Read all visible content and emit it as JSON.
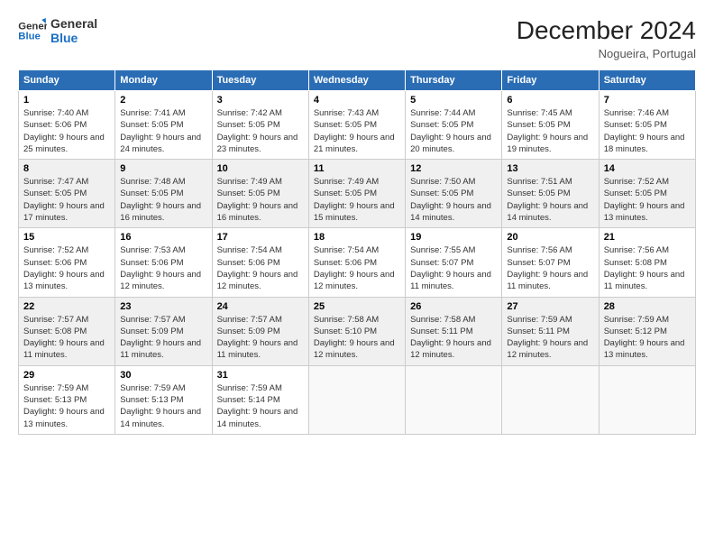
{
  "header": {
    "logo_line1": "General",
    "logo_line2": "Blue",
    "month": "December 2024",
    "location": "Nogueira, Portugal"
  },
  "weekdays": [
    "Sunday",
    "Monday",
    "Tuesday",
    "Wednesday",
    "Thursday",
    "Friday",
    "Saturday"
  ],
  "weeks": [
    [
      {
        "day": "1",
        "sunrise": "Sunrise: 7:40 AM",
        "sunset": "Sunset: 5:06 PM",
        "daylight": "Daylight: 9 hours and 25 minutes."
      },
      {
        "day": "2",
        "sunrise": "Sunrise: 7:41 AM",
        "sunset": "Sunset: 5:05 PM",
        "daylight": "Daylight: 9 hours and 24 minutes."
      },
      {
        "day": "3",
        "sunrise": "Sunrise: 7:42 AM",
        "sunset": "Sunset: 5:05 PM",
        "daylight": "Daylight: 9 hours and 23 minutes."
      },
      {
        "day": "4",
        "sunrise": "Sunrise: 7:43 AM",
        "sunset": "Sunset: 5:05 PM",
        "daylight": "Daylight: 9 hours and 21 minutes."
      },
      {
        "day": "5",
        "sunrise": "Sunrise: 7:44 AM",
        "sunset": "Sunset: 5:05 PM",
        "daylight": "Daylight: 9 hours and 20 minutes."
      },
      {
        "day": "6",
        "sunrise": "Sunrise: 7:45 AM",
        "sunset": "Sunset: 5:05 PM",
        "daylight": "Daylight: 9 hours and 19 minutes."
      },
      {
        "day": "7",
        "sunrise": "Sunrise: 7:46 AM",
        "sunset": "Sunset: 5:05 PM",
        "daylight": "Daylight: 9 hours and 18 minutes."
      }
    ],
    [
      {
        "day": "8",
        "sunrise": "Sunrise: 7:47 AM",
        "sunset": "Sunset: 5:05 PM",
        "daylight": "Daylight: 9 hours and 17 minutes."
      },
      {
        "day": "9",
        "sunrise": "Sunrise: 7:48 AM",
        "sunset": "Sunset: 5:05 PM",
        "daylight": "Daylight: 9 hours and 16 minutes."
      },
      {
        "day": "10",
        "sunrise": "Sunrise: 7:49 AM",
        "sunset": "Sunset: 5:05 PM",
        "daylight": "Daylight: 9 hours and 16 minutes."
      },
      {
        "day": "11",
        "sunrise": "Sunrise: 7:49 AM",
        "sunset": "Sunset: 5:05 PM",
        "daylight": "Daylight: 9 hours and 15 minutes."
      },
      {
        "day": "12",
        "sunrise": "Sunrise: 7:50 AM",
        "sunset": "Sunset: 5:05 PM",
        "daylight": "Daylight: 9 hours and 14 minutes."
      },
      {
        "day": "13",
        "sunrise": "Sunrise: 7:51 AM",
        "sunset": "Sunset: 5:05 PM",
        "daylight": "Daylight: 9 hours and 14 minutes."
      },
      {
        "day": "14",
        "sunrise": "Sunrise: 7:52 AM",
        "sunset": "Sunset: 5:05 PM",
        "daylight": "Daylight: 9 hours and 13 minutes."
      }
    ],
    [
      {
        "day": "15",
        "sunrise": "Sunrise: 7:52 AM",
        "sunset": "Sunset: 5:06 PM",
        "daylight": "Daylight: 9 hours and 13 minutes."
      },
      {
        "day": "16",
        "sunrise": "Sunrise: 7:53 AM",
        "sunset": "Sunset: 5:06 PM",
        "daylight": "Daylight: 9 hours and 12 minutes."
      },
      {
        "day": "17",
        "sunrise": "Sunrise: 7:54 AM",
        "sunset": "Sunset: 5:06 PM",
        "daylight": "Daylight: 9 hours and 12 minutes."
      },
      {
        "day": "18",
        "sunrise": "Sunrise: 7:54 AM",
        "sunset": "Sunset: 5:06 PM",
        "daylight": "Daylight: 9 hours and 12 minutes."
      },
      {
        "day": "19",
        "sunrise": "Sunrise: 7:55 AM",
        "sunset": "Sunset: 5:07 PM",
        "daylight": "Daylight: 9 hours and 11 minutes."
      },
      {
        "day": "20",
        "sunrise": "Sunrise: 7:56 AM",
        "sunset": "Sunset: 5:07 PM",
        "daylight": "Daylight: 9 hours and 11 minutes."
      },
      {
        "day": "21",
        "sunrise": "Sunrise: 7:56 AM",
        "sunset": "Sunset: 5:08 PM",
        "daylight": "Daylight: 9 hours and 11 minutes."
      }
    ],
    [
      {
        "day": "22",
        "sunrise": "Sunrise: 7:57 AM",
        "sunset": "Sunset: 5:08 PM",
        "daylight": "Daylight: 9 hours and 11 minutes."
      },
      {
        "day": "23",
        "sunrise": "Sunrise: 7:57 AM",
        "sunset": "Sunset: 5:09 PM",
        "daylight": "Daylight: 9 hours and 11 minutes."
      },
      {
        "day": "24",
        "sunrise": "Sunrise: 7:57 AM",
        "sunset": "Sunset: 5:09 PM",
        "daylight": "Daylight: 9 hours and 11 minutes."
      },
      {
        "day": "25",
        "sunrise": "Sunrise: 7:58 AM",
        "sunset": "Sunset: 5:10 PM",
        "daylight": "Daylight: 9 hours and 12 minutes."
      },
      {
        "day": "26",
        "sunrise": "Sunrise: 7:58 AM",
        "sunset": "Sunset: 5:11 PM",
        "daylight": "Daylight: 9 hours and 12 minutes."
      },
      {
        "day": "27",
        "sunrise": "Sunrise: 7:59 AM",
        "sunset": "Sunset: 5:11 PM",
        "daylight": "Daylight: 9 hours and 12 minutes."
      },
      {
        "day": "28",
        "sunrise": "Sunrise: 7:59 AM",
        "sunset": "Sunset: 5:12 PM",
        "daylight": "Daylight: 9 hours and 13 minutes."
      }
    ],
    [
      {
        "day": "29",
        "sunrise": "Sunrise: 7:59 AM",
        "sunset": "Sunset: 5:13 PM",
        "daylight": "Daylight: 9 hours and 13 minutes."
      },
      {
        "day": "30",
        "sunrise": "Sunrise: 7:59 AM",
        "sunset": "Sunset: 5:13 PM",
        "daylight": "Daylight: 9 hours and 14 minutes."
      },
      {
        "day": "31",
        "sunrise": "Sunrise: 7:59 AM",
        "sunset": "Sunset: 5:14 PM",
        "daylight": "Daylight: 9 hours and 14 minutes."
      },
      null,
      null,
      null,
      null
    ]
  ]
}
